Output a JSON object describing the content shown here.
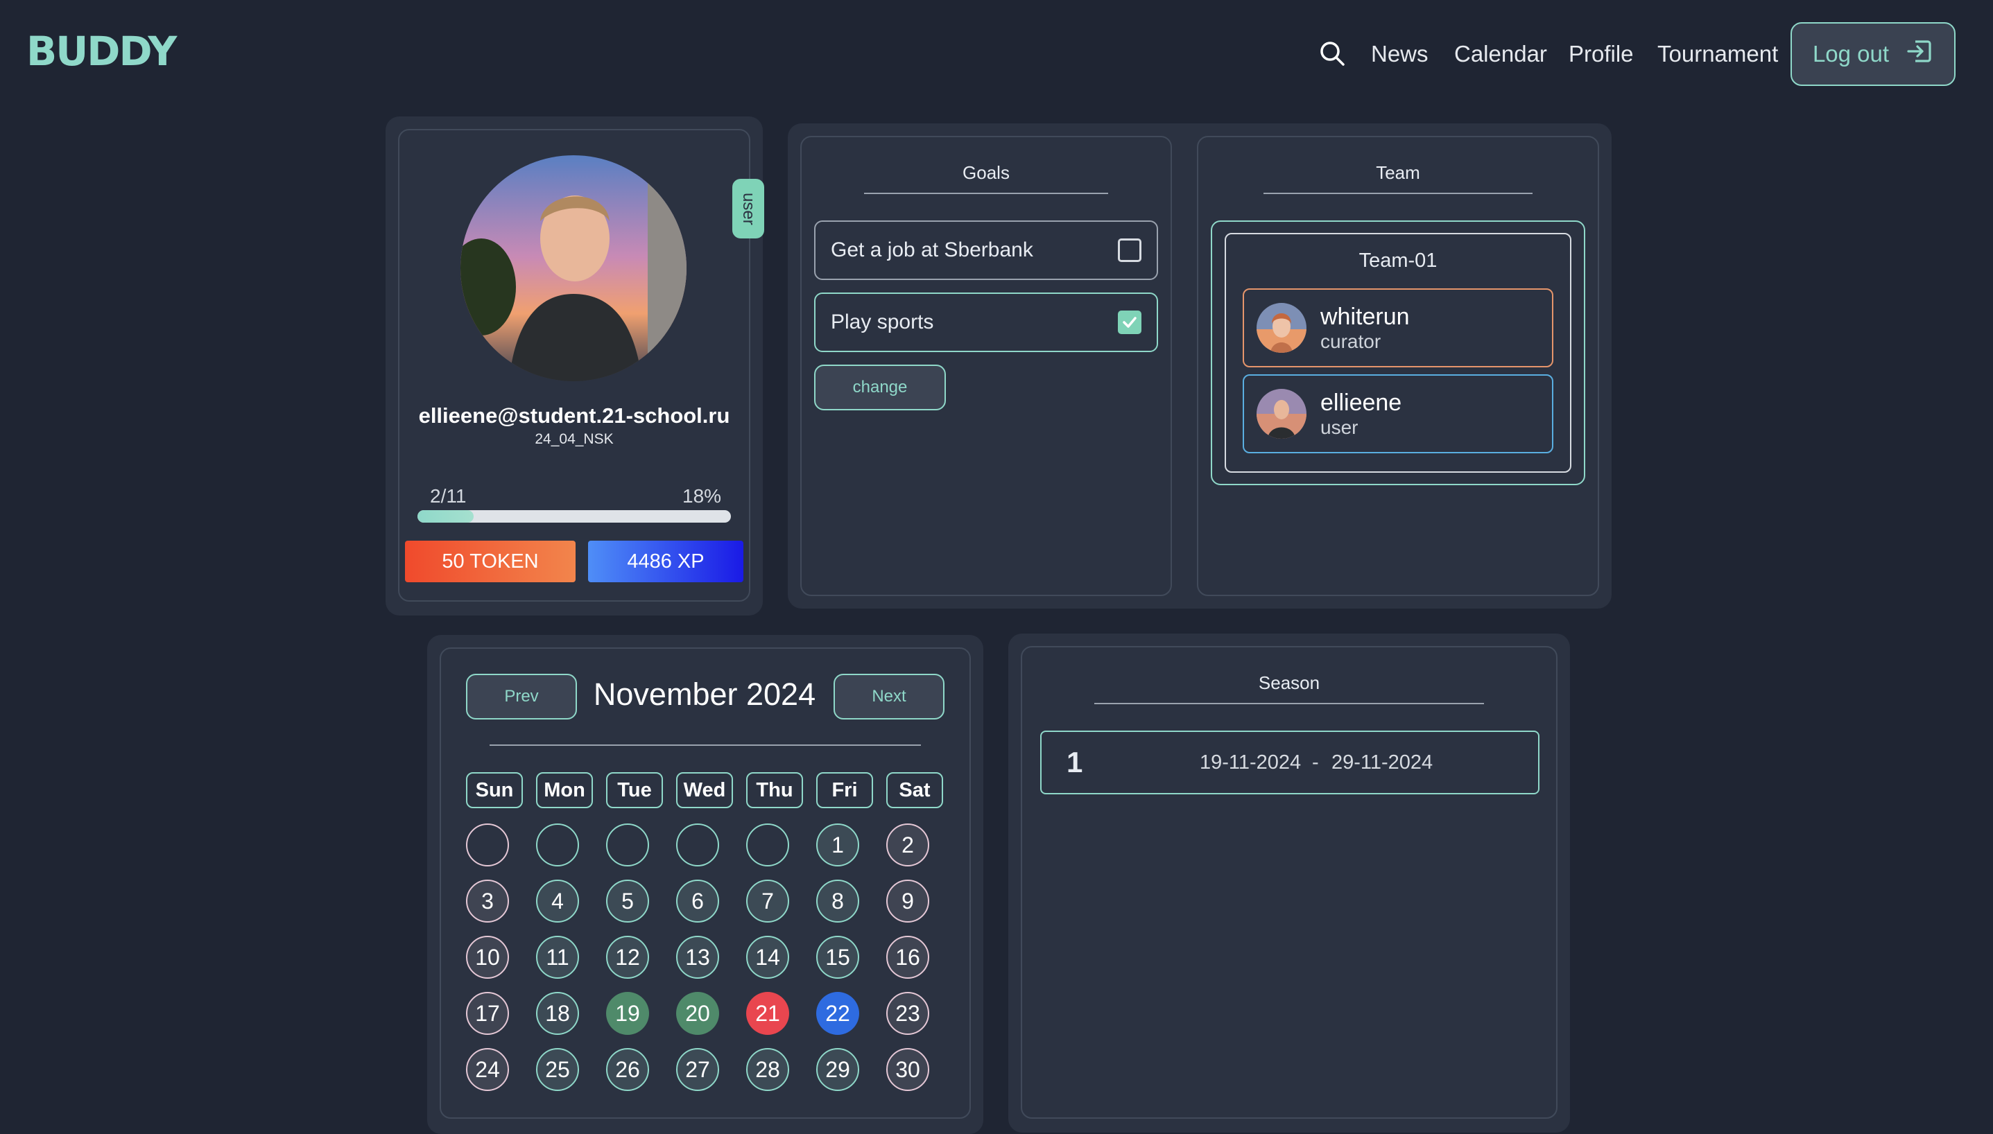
{
  "header": {
    "logo": "BUDDY",
    "nav": [
      "News",
      "Calendar",
      "Profile",
      "Tournament"
    ],
    "logout_label": "Log out"
  },
  "profile": {
    "role_tab": "user",
    "email": "ellieene@student.21-school.ru",
    "group": "24_04_NSK",
    "progress_count": "2/11",
    "progress_percent_label": "18%",
    "progress_fraction": 0.18,
    "token_label": "50 TOKEN",
    "xp_label": "4486 XP"
  },
  "goals": {
    "title": "Goals",
    "items": [
      {
        "label": "Get a job at Sberbank",
        "checked": false
      },
      {
        "label": "Play sports",
        "checked": true
      }
    ],
    "change_label": "change"
  },
  "team": {
    "title": "Team",
    "team_name": "Team-01",
    "members": [
      {
        "name": "whiterun",
        "role": "curator"
      },
      {
        "name": "ellieene",
        "role": "user"
      }
    ]
  },
  "calendar": {
    "prev_label": "Prev",
    "next_label": "Next",
    "month_label": "November 2024",
    "weekdays": [
      "Sun",
      "Mon",
      "Tue",
      "Wed",
      "Thu",
      "Fri",
      "Sat"
    ],
    "days": [
      "",
      "",
      "",
      "",
      "",
      "1",
      "2",
      "3",
      "4",
      "5",
      "6",
      "7",
      "8",
      "9",
      "10",
      "11",
      "12",
      "13",
      "14",
      "15",
      "16",
      "17",
      "18",
      "19",
      "20",
      "21",
      "22",
      "23",
      "24",
      "25",
      "26",
      "27",
      "28",
      "29",
      "30"
    ],
    "highlights": {
      "19": "green",
      "20": "green",
      "21": "red",
      "22": "blue"
    }
  },
  "season": {
    "title": "Season",
    "number": "1",
    "start": "19-11-2024",
    "separator": "-",
    "end": "29-11-2024"
  },
  "colors": {
    "background": "#1f2533",
    "panel": "#2b3241",
    "accent": "#8fd8c9",
    "token": "#f04a2c",
    "xp": "#1a1ae6",
    "curator_border": "#e5956b",
    "user_border": "#5aaee0"
  }
}
